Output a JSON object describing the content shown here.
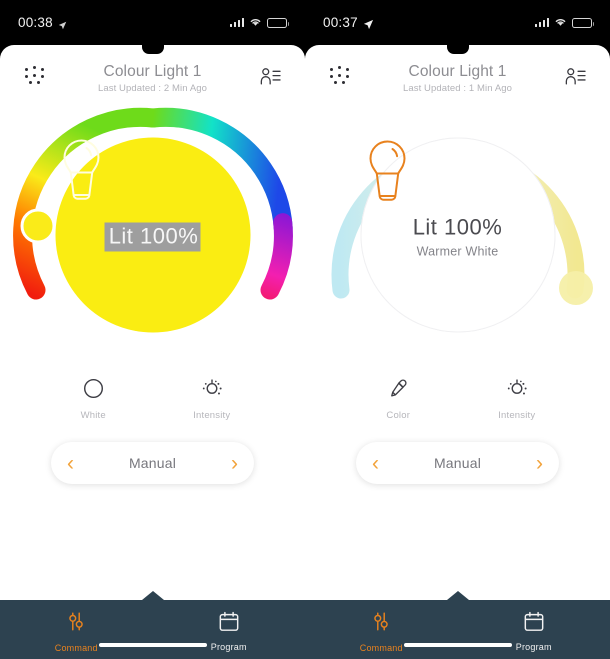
{
  "phones": [
    {
      "id": "left",
      "status": {
        "time": "00:38",
        "location_icon": "location-arrow-icon",
        "signal_icon": "signal-bars-icon",
        "wifi_icon": "wifi-icon",
        "battery_icon": "battery-icon"
      },
      "header": {
        "menu_icon": "dot-grid-icon",
        "title": "Colour Light 1",
        "subtitle": "Last Updated : 2 Min Ago",
        "users_icon": "user-list-icon"
      },
      "dial": {
        "mode": "colour",
        "arc_type": "rainbow",
        "handle_angle": -175,
        "handle_color": "#FAEB19",
        "face_color": "#FAED12",
        "bulb_icon": "light-bulb-icon",
        "bulb_color": "#FFFDE0",
        "status_text": "Lit 100%",
        "status_selected": true,
        "sub_text": ""
      },
      "controls": [
        {
          "icon": "white-circle-icon",
          "label": "White"
        },
        {
          "icon": "brightness-icon",
          "label": "Intensity"
        }
      ],
      "mode": {
        "prev_icon": "chevron-left-icon",
        "label": "Manual",
        "next_icon": "chevron-right-icon"
      },
      "nav": [
        {
          "icon": "sliders-icon",
          "label": "Command",
          "active": true
        },
        {
          "icon": "calendar-icon",
          "label": "Program",
          "active": false
        }
      ]
    },
    {
      "id": "right",
      "status": {
        "time": "00:37",
        "location_icon": "navigation-arrow-icon",
        "signal_icon": "signal-bars-icon",
        "wifi_icon": "wifi-icon",
        "battery_icon": "battery-icon"
      },
      "header": {
        "menu_icon": "dot-grid-icon",
        "title": "Colour Light 1",
        "subtitle": "Last Updated : 1 Min Ago",
        "users_icon": "user-list-icon"
      },
      "dial": {
        "mode": "white",
        "arc_type": "white-temperature",
        "handle_angle": 5,
        "handle_color": "#F6EFA8",
        "face_color": "#FFFFFF",
        "bulb_icon": "light-bulb-icon",
        "bulb_color": "#E8821E",
        "status_text": "Lit 100%",
        "status_selected": false,
        "sub_text": "Warmer White"
      },
      "controls": [
        {
          "icon": "eyedropper-icon",
          "label": "Color"
        },
        {
          "icon": "brightness-icon",
          "label": "Intensity"
        }
      ],
      "mode": {
        "prev_icon": "chevron-left-icon",
        "label": "Manual",
        "next_icon": "chevron-right-icon"
      },
      "nav": [
        {
          "icon": "sliders-icon",
          "label": "Command",
          "active": true
        },
        {
          "icon": "calendar-icon",
          "label": "Program",
          "active": false
        }
      ]
    }
  ],
  "colors": {
    "accent_orange": "#E8821E",
    "chevron_orange": "#F2A33C",
    "navbar": "#2d4250",
    "yellow_face": "#FAED12",
    "text_grey": "#8d8d92"
  }
}
